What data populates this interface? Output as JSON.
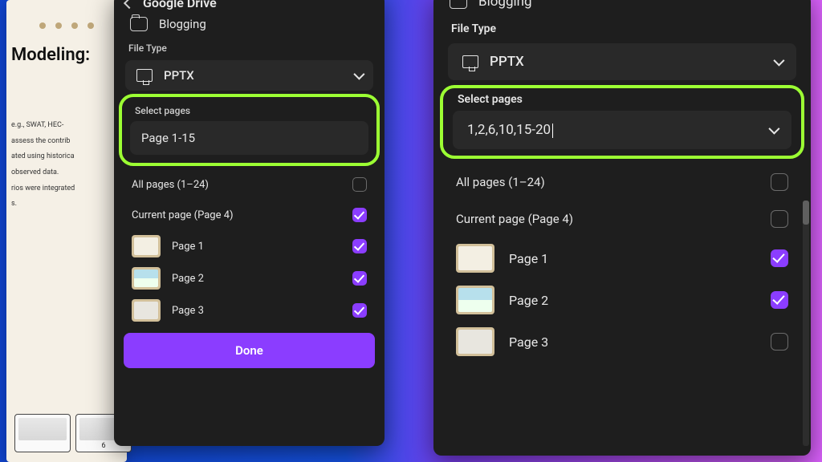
{
  "canvas": {
    "title": "Modeling:",
    "line1": "e.g., SWAT, HEC-",
    "line2": "assess the contrib",
    "line3": "ated using historica",
    "line4": "observed data.",
    "line5": "rios were integrated",
    "line6": "s.",
    "thumb_num": "6"
  },
  "left": {
    "drive_title": "Google Drive",
    "folder": "Blogging",
    "file_type_label": "File Type",
    "file_type_value": "PPTX",
    "select_pages_label": "Select pages",
    "page_input_value": "Page 1-15",
    "all_pages_label": "All pages (1–24)",
    "current_page_label": "Current page (Page 4)",
    "pages": {
      "p1": "Page 1",
      "p2": "Page 2",
      "p3": "Page 3"
    },
    "done": "Done"
  },
  "right": {
    "folder": "Blogging",
    "file_type_label": "File Type",
    "file_type_value": "PPTX",
    "select_pages_label": "Select pages",
    "page_input_value": "1,2,6,10,15-20",
    "all_pages_label": "All pages (1–24)",
    "current_page_label": "Current page (Page 4)",
    "pages": {
      "p1": "Page 1",
      "p2": "Page 2",
      "p3": "Page 3"
    }
  },
  "colors": {
    "accent": "#8b3dff",
    "highlight": "#9cff33"
  }
}
